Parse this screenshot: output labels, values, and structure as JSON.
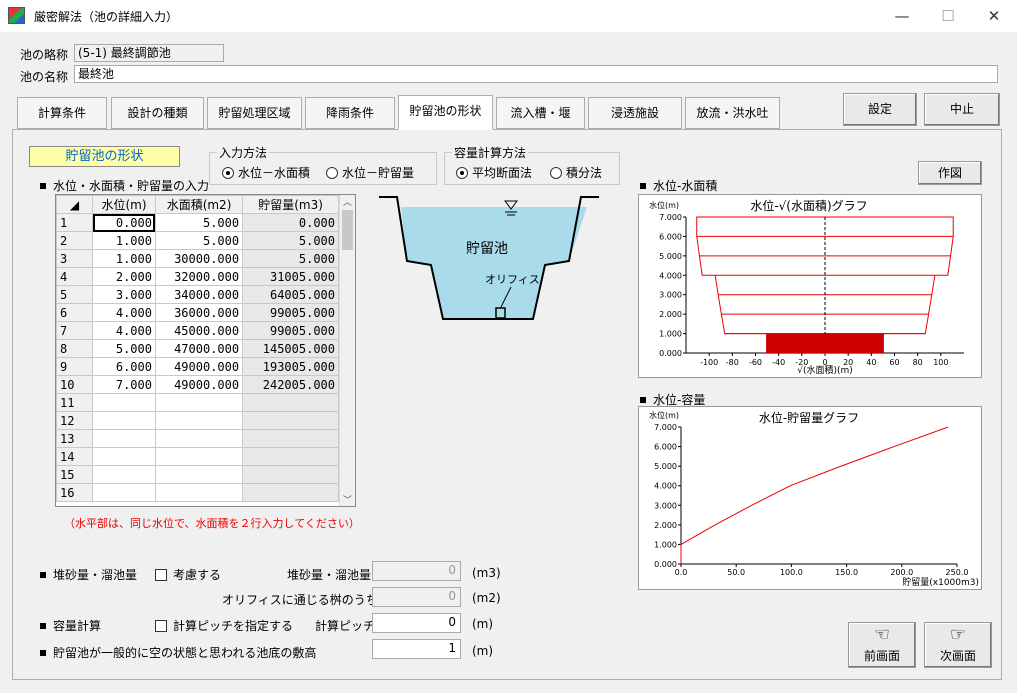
{
  "window": {
    "title": "厳密解法（池の詳細入力）",
    "min": "—",
    "max": "☐",
    "close": "✕"
  },
  "pond": {
    "abbr_label": "池の略称",
    "abbr_value": "(5-1) 最終調節池",
    "name_label": "池の名称",
    "name_value": "最終池"
  },
  "tabs": [
    "計算条件",
    "設計の種類",
    "貯留処理区域",
    "降雨条件",
    "貯留池の形状",
    "流入槽・堰",
    "浸透施設",
    "放流・洪水吐"
  ],
  "buttons": {
    "settings": "設定",
    "cancel": "中止",
    "draw": "作図",
    "prev": "前画面",
    "next": "次画面"
  },
  "section_title": "貯留池の形状",
  "input_method": {
    "title": "入力方法",
    "opt1": "水位－水面積",
    "opt2": "水位－貯留量"
  },
  "capacity_method": {
    "title": "容量計算方法",
    "opt1": "平均断面法",
    "opt2": "積分法"
  },
  "table": {
    "heading": "水位・水面積・貯留量の入力",
    "headers": [
      "水位(m)",
      "水面積(m2)",
      "貯留量(m3)"
    ],
    "rows": [
      [
        "1",
        "0.000",
        "5.000",
        "0.000"
      ],
      [
        "2",
        "1.000",
        "5.000",
        "5.000"
      ],
      [
        "3",
        "1.000",
        "30000.000",
        "5.000"
      ],
      [
        "4",
        "2.000",
        "32000.000",
        "31005.000"
      ],
      [
        "5",
        "3.000",
        "34000.000",
        "64005.000"
      ],
      [
        "6",
        "4.000",
        "36000.000",
        "99005.000"
      ],
      [
        "7",
        "4.000",
        "45000.000",
        "99005.000"
      ],
      [
        "8",
        "5.000",
        "47000.000",
        "145005.000"
      ],
      [
        "9",
        "6.000",
        "49000.000",
        "193005.000"
      ],
      [
        "10",
        "7.000",
        "49000.000",
        "242005.000"
      ],
      [
        "11",
        "",
        "",
        ""
      ],
      [
        "12",
        "",
        "",
        ""
      ],
      [
        "13",
        "",
        "",
        ""
      ],
      [
        "14",
        "",
        "",
        ""
      ],
      [
        "15",
        "",
        "",
        ""
      ],
      [
        "16",
        "",
        "",
        ""
      ]
    ]
  },
  "note": "（水平部は、同じ水位で、水面積を２行入力してください）",
  "diagram": {
    "pond_label": "貯留池",
    "orifice_label": "オリフィス"
  },
  "sediment": {
    "label": "堆砂量・溜池量",
    "check_label": "考慮する",
    "field_label": "堆砂量・溜池量",
    "value": "0",
    "unit": "(m3)"
  },
  "orifice_area": {
    "label": "オリフィスに通じる桝のうち面積",
    "value": "0",
    "unit": "(m2)"
  },
  "capacity": {
    "label": "容量計算",
    "check_label": "計算ピッチを指定する",
    "field_label": "計算ピッチ",
    "value": "0",
    "unit": "(m)"
  },
  "bottom": {
    "label": "貯留池が一般的に空の状態と思われる池底の敷高",
    "value": "1",
    "unit": "(m)"
  },
  "chart1_heading": "水位-水面積",
  "chart2_heading": "水位-容量",
  "chart_data": [
    {
      "type": "line",
      "title": "水位-√(水面積)グラフ",
      "ylabel": "水位(m)",
      "xlabel": "√(水面積)(m)",
      "xlim": [
        -120,
        120
      ],
      "ylim": [
        0,
        7
      ],
      "xticks": [
        "-100",
        "-80",
        "-60",
        "-40",
        "-20",
        "0",
        "20",
        "40",
        "60",
        "80",
        "100"
      ],
      "yticks": [
        "0.000",
        "1.000",
        "2.000",
        "3.000",
        "4.000",
        "5.000",
        "6.000",
        "7.000"
      ],
      "x": [
        0,
        100,
        173.2,
        178.9,
        184.4,
        189.7,
        212.1,
        216.8,
        221.4,
        221.4
      ],
      "y": [
        0,
        1,
        1,
        2,
        3,
        4,
        4,
        5,
        6,
        7
      ]
    },
    {
      "type": "line",
      "title": "水位-貯留量グラフ",
      "ylabel": "水位(m)",
      "xlabel": "貯留量(x1000m3)",
      "xlim": [
        0,
        250
      ],
      "ylim": [
        0,
        7
      ],
      "xticks": [
        "0.0",
        "50.0",
        "100.0",
        "150.0",
        "200.0",
        "250.0"
      ],
      "yticks": [
        "0.000",
        "1.000",
        "2.000",
        "3.000",
        "4.000",
        "5.000",
        "6.000",
        "7.000"
      ],
      "series": [
        {
          "x": [
            0,
            0.005,
            31.005,
            64.005,
            99.005,
            145.005,
            193.005,
            242.005
          ],
          "y": [
            0,
            1,
            2,
            3,
            4,
            5,
            6,
            7
          ]
        }
      ]
    }
  ]
}
